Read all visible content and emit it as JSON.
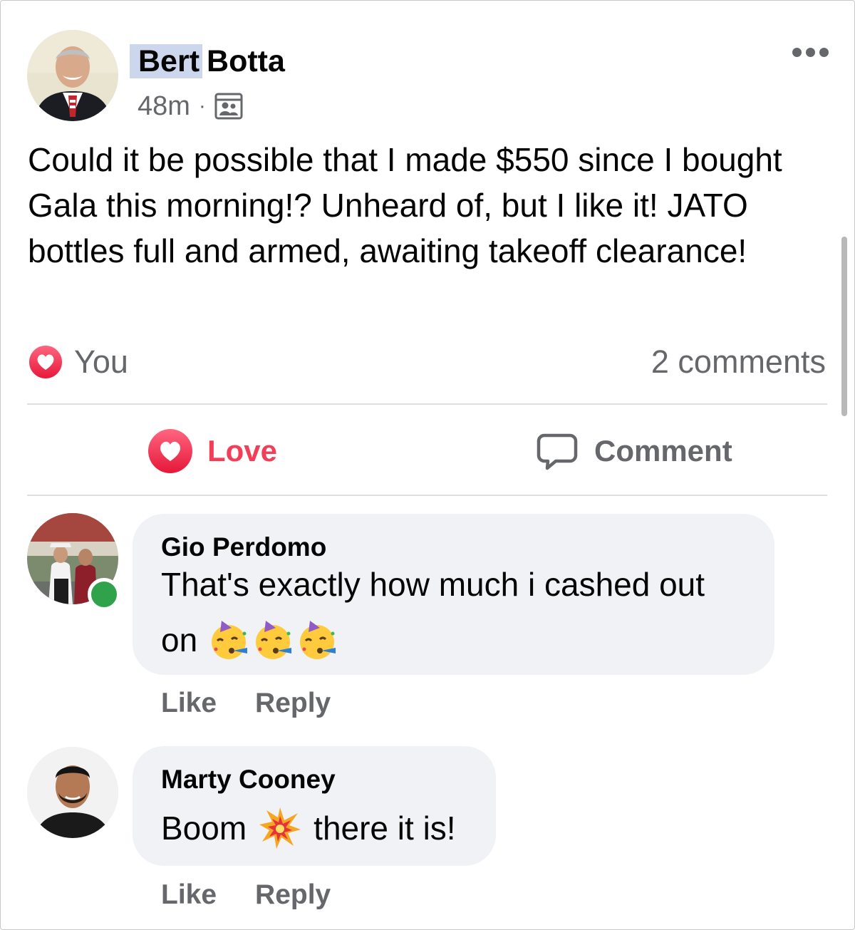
{
  "post": {
    "author_first": "Bert",
    "author_last": "Botta",
    "time": "48m",
    "separator": "·",
    "audience_icon": "group-audience-icon",
    "text": "Could it be possible that I made $550 since I bought Gala this morning!? Unheard of, but I like it! JATO bottles full and armed, awaiting takeoff clearance!",
    "reaction_icon": "love-heart-icon",
    "reaction_by": "You",
    "comments_count": "2 comments"
  },
  "actions": {
    "love_label": "Love",
    "comment_label": "Comment"
  },
  "comments": [
    {
      "name": "Gio Perdomo",
      "text_line1": "That's exactly how much i cashed out",
      "text_line2": "on",
      "emoji": [
        "partying-face-emoji",
        "partying-face-emoji",
        "partying-face-emoji"
      ],
      "online": true,
      "like_label": "Like",
      "reply_label": "Reply"
    },
    {
      "name": "Marty Cooney",
      "text_before": "Boom",
      "emoji": "collision-emoji",
      "text_after": "there it is!",
      "like_label": "Like",
      "reply_label": "Reply"
    }
  ],
  "colors": {
    "love": "#f33e58",
    "secondary_text": "#65676b",
    "bubble": "#f0f2f5",
    "online": "#31a24c",
    "name_highlight": "#ccd6ec"
  }
}
